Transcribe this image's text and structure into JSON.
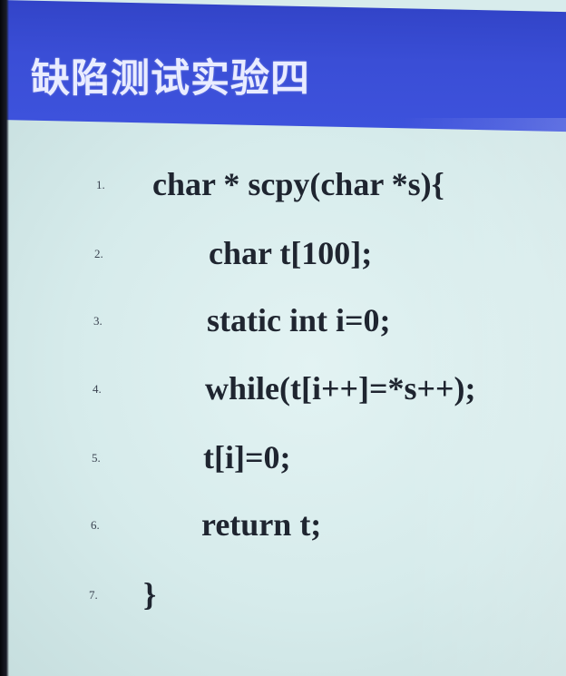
{
  "slide": {
    "title": "缺陷测试实验四",
    "code_lines": [
      {
        "num": "1.",
        "text": "char * scpy(char *s){"
      },
      {
        "num": "2.",
        "text": "char t[100];"
      },
      {
        "num": "3.",
        "text": "static int i=0;"
      },
      {
        "num": "4.",
        "text": "while(t[i++]=*s++);"
      },
      {
        "num": "5.",
        "text": "t[i]=0;"
      },
      {
        "num": "6.",
        "text": "return t;"
      },
      {
        "num": "7.",
        "text": "}"
      }
    ]
  },
  "colors": {
    "title_bar": "#3a4ed6",
    "title_text": "#e9ecff",
    "content_bg": "#d8ecec",
    "code_text": "#1f2530"
  }
}
